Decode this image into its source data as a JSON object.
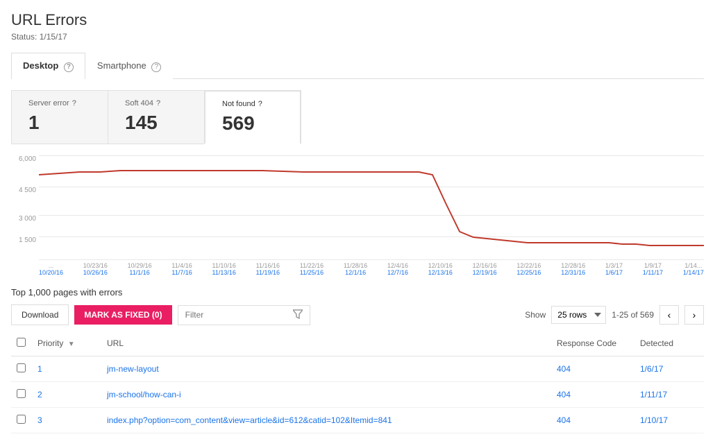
{
  "page": {
    "title": "URL Errors",
    "status": "Status: 1/15/17"
  },
  "tabs": [
    {
      "id": "desktop",
      "label": "Desktop",
      "active": true
    },
    {
      "id": "smartphone",
      "label": "Smartphone",
      "active": false
    }
  ],
  "error_cards": [
    {
      "id": "server-error",
      "label": "Server error",
      "value": "1",
      "active": false
    },
    {
      "id": "soft-404",
      "label": "Soft 404",
      "value": "145",
      "active": false
    },
    {
      "id": "not-found",
      "label": "Not found",
      "value": "569",
      "active": true
    }
  ],
  "chart": {
    "y_labels": [
      "6,000",
      "4 500",
      "3 000",
      "1 500",
      ""
    ],
    "x_labels": [
      {
        "top": "10/20/16",
        "bottom": "10/20/16"
      },
      {
        "top": "10/23/16",
        "bottom": "10/26/16"
      },
      {
        "top": "10/29/16",
        "bottom": "11/1/16"
      },
      {
        "top": "11/4/16",
        "bottom": "11/7/16"
      },
      {
        "top": "11/10/16",
        "bottom": "11/13/16"
      },
      {
        "top": "11/16/16",
        "bottom": "11/19/16"
      },
      {
        "top": "11/22/16",
        "bottom": "11/25/16"
      },
      {
        "top": "11/28/16",
        "bottom": "12/1/16"
      },
      {
        "top": "12/4/16",
        "bottom": "12/7/16"
      },
      {
        "top": "12/10/16",
        "bottom": "12/13/16"
      },
      {
        "top": "12/16/16",
        "bottom": "12/19/16"
      },
      {
        "top": "12/22/16",
        "bottom": "12/25/16"
      },
      {
        "top": "12/28/16",
        "bottom": "12/31/16"
      },
      {
        "top": "1/3/17",
        "bottom": "1/6/17"
      },
      {
        "top": "1/9/17",
        "bottom": "1/11/17"
      },
      {
        "top": "1/14...",
        "bottom": "1/14/17"
      }
    ]
  },
  "section": {
    "title": "Top 1,000 pages with errors"
  },
  "toolbar": {
    "download_label": "Download",
    "mark_fixed_label": "MARK AS FIXED (0)",
    "filter_placeholder": "Filter",
    "show_label": "Show",
    "rows_option": "25 rows",
    "pagination_text": "1-25 of 569"
  },
  "table": {
    "headers": [
      "",
      "Priority",
      "URL",
      "Response Code",
      "Detected"
    ],
    "rows": [
      {
        "check": false,
        "priority": "1",
        "url": "jm-new-layout",
        "response_code": "404",
        "detected": "1/6/17"
      },
      {
        "check": false,
        "priority": "2",
        "url": "jm-school/how-can-i",
        "response_code": "404",
        "detected": "1/11/17"
      },
      {
        "check": false,
        "priority": "3",
        "url": "index.php?option=com_content&view=article&id=612&catid=102&Itemid=841",
        "response_code": "404",
        "detected": "1/10/17"
      }
    ]
  },
  "colors": {
    "accent": "#e91e63",
    "link": "#1a73e8",
    "chart_line": "#c0392b"
  }
}
